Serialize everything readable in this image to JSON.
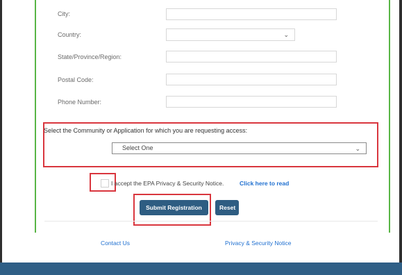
{
  "form": {
    "fields": [
      {
        "label": "City:",
        "type": "text",
        "value": ""
      },
      {
        "label": "Country:",
        "type": "select",
        "value": ""
      },
      {
        "label": "State/Province/Region:",
        "type": "text",
        "value": ""
      },
      {
        "label": "Postal Code:",
        "type": "text",
        "value": ""
      },
      {
        "label": "Phone Number:",
        "type": "text",
        "value": ""
      }
    ],
    "community_label": "Select the Community or Application for which you are requesting access:",
    "community_select_value": "Select One",
    "accept_text": "I accept the EPA Privacy & Security Notice.",
    "accept_link": "Click here to read",
    "accept_checked": false,
    "submit_label": "Submit Registration",
    "reset_label": "Reset"
  },
  "footer": {
    "contact_label": "Contact Us",
    "privacy_label": "Privacy & Security Notice"
  },
  "icons": {
    "select_arrow": "chevron-down-icon"
  },
  "colors": {
    "accent_green": "#58b545",
    "button_blue": "#2e5d82",
    "link_blue": "#1e6fd0",
    "highlight_red": "#d9363e",
    "footer_band": "#2f5f86"
  }
}
